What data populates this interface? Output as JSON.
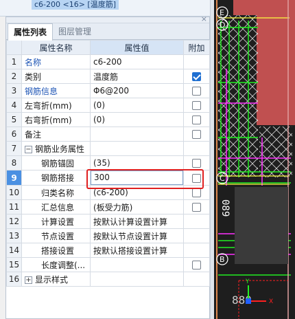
{
  "top_selection": "c6-200 <16> [温度筋]",
  "panel": {
    "close_glyph": "×"
  },
  "tabs": [
    {
      "label": "属性列表",
      "active": true
    },
    {
      "label": "图层管理",
      "active": false
    }
  ],
  "columns": {
    "name": "属性名称",
    "value": "属性值",
    "extra": "附加"
  },
  "rows": [
    {
      "num": "1",
      "name": "名称",
      "value": "c6-200",
      "blue": true
    },
    {
      "num": "2",
      "name": "类别",
      "value": "温度筋",
      "checkbox": "checked"
    },
    {
      "num": "3",
      "name": "钢筋信息",
      "value": "Φ6@200",
      "blue": true,
      "checkbox": "unchecked"
    },
    {
      "num": "4",
      "name": "左弯折(mm)",
      "value": "(0)",
      "checkbox": "unchecked"
    },
    {
      "num": "5",
      "name": "右弯折(mm)",
      "value": "(0)",
      "checkbox": "unchecked"
    },
    {
      "num": "6",
      "name": "备注",
      "value": "",
      "checkbox": "unchecked"
    },
    {
      "num": "7",
      "name": "钢筋业务属性",
      "value": "",
      "expander": "−"
    },
    {
      "num": "8",
      "name": "钢筋锚固",
      "value": "(35)",
      "sub": true,
      "checkbox": "unchecked"
    },
    {
      "num": "9",
      "name": "钢筋搭接",
      "value": "300",
      "sub": true,
      "selected": true,
      "editing": true,
      "checkbox": "unchecked"
    },
    {
      "num": "10",
      "name": "归类名称",
      "value": "(c6-200)",
      "sub": true,
      "checkbox": "unchecked"
    },
    {
      "num": "11",
      "name": "汇总信息",
      "value": "(板受力筋)",
      "sub": true,
      "checkbox": "unchecked"
    },
    {
      "num": "12",
      "name": "计算设置",
      "value": "按默认计算设置计算",
      "sub": true
    },
    {
      "num": "13",
      "name": "节点设置",
      "value": "按默认节点设置计算",
      "sub": true
    },
    {
      "num": "14",
      "name": "搭接设置",
      "value": "按默认搭接设置计算",
      "sub": true
    },
    {
      "num": "15",
      "name": "长度调整(...",
      "value": "",
      "sub": true,
      "checkbox": "unchecked"
    },
    {
      "num": "16",
      "name": "显示样式",
      "value": "",
      "expander": "+"
    }
  ],
  "cad": {
    "axis_labels": [
      "E",
      "D",
      "C",
      "B"
    ],
    "dimension_text": "089",
    "bottom_text": "880",
    "axis_x": "X",
    "axis_y": "Y",
    "colors": {
      "green": "#22ee22",
      "magenta": "#ff30ff",
      "yellow": "#ffff40",
      "red": "#ff2020",
      "wall": "#c05050",
      "orange": "#e08a50"
    }
  }
}
